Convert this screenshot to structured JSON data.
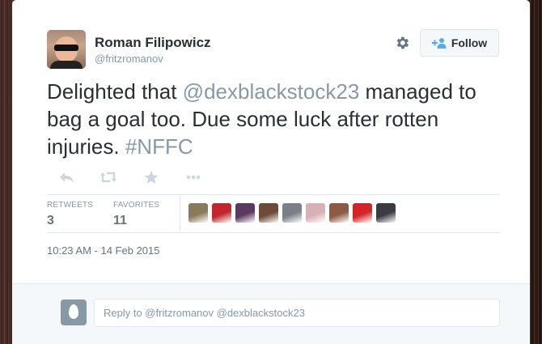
{
  "tweet": {
    "author_name": "Roman Filipowicz",
    "author_handle": "@fritzromanov",
    "follow_label": "Follow",
    "text_before": "Delighted that ",
    "mention": "@dexblackstock23",
    "text_middle": " managed to bag a goal too. Due some luck after rotten injuries. ",
    "hashtag": "#NFFC",
    "timestamp": "10:23 AM - 14 Feb 2015"
  },
  "actions": {
    "icons": [
      "reply-icon",
      "retweet-icon",
      "favorite-icon",
      "more-icon"
    ]
  },
  "stats": {
    "retweets_label": "RETWEETS",
    "retweets_count": "3",
    "favorites_label": "FAVORITES",
    "favorites_count": "11"
  },
  "favoriters": {
    "count": 9,
    "colors": [
      "#8a7a5c",
      "#c0282d",
      "#5a3a5e",
      "#6d4a3a",
      "#7a7f88",
      "#d7b0b8",
      "#8c5a45",
      "#d3242a",
      "#3c3b44"
    ]
  },
  "reply": {
    "placeholder": "Reply to @fritzromanov @dexblackstock23"
  },
  "colors": {
    "text_primary": "#292f33",
    "text_muted": "#8899a6",
    "link_gray": "#8899a6",
    "follow_icon_blue": "#55acee"
  }
}
